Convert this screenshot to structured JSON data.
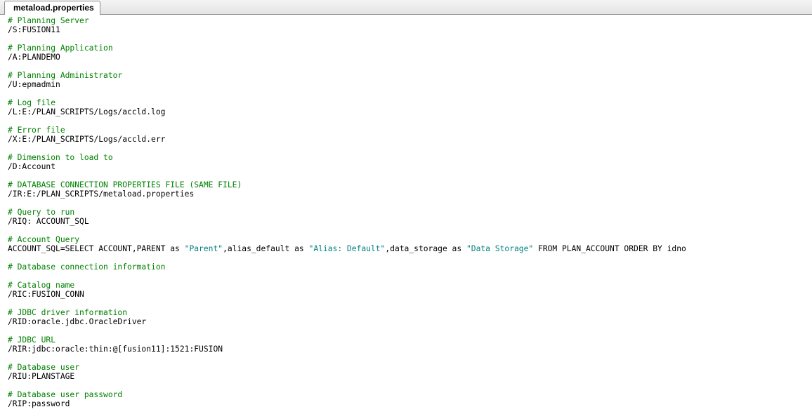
{
  "tab": {
    "label": "metaload.properties"
  },
  "lines": [
    {
      "kind": "comment",
      "text": "# Planning Server"
    },
    {
      "kind": "text",
      "text": "/S:FUSION11"
    },
    {
      "kind": "blank"
    },
    {
      "kind": "comment",
      "text": "# Planning Application"
    },
    {
      "kind": "text",
      "text": "/A:PLANDEMO"
    },
    {
      "kind": "blank"
    },
    {
      "kind": "comment",
      "text": "# Planning Administrator"
    },
    {
      "kind": "text",
      "text": "/U:epmadmin"
    },
    {
      "kind": "blank"
    },
    {
      "kind": "comment",
      "text": "# Log file"
    },
    {
      "kind": "text",
      "text": "/L:E:/PLAN_SCRIPTS/Logs/accld.log"
    },
    {
      "kind": "blank"
    },
    {
      "kind": "comment",
      "text": "# Error file"
    },
    {
      "kind": "text",
      "text": "/X:E:/PLAN_SCRIPTS/Logs/accld.err"
    },
    {
      "kind": "blank"
    },
    {
      "kind": "comment",
      "text": "# Dimension to load to"
    },
    {
      "kind": "text",
      "text": "/D:Account"
    },
    {
      "kind": "blank"
    },
    {
      "kind": "comment",
      "text": "# DATABASE CONNECTION PROPERTIES FILE (SAME FILE)"
    },
    {
      "kind": "text",
      "text": "/IR:E:/PLAN_SCRIPTS/metaload.properties"
    },
    {
      "kind": "blank"
    },
    {
      "kind": "comment",
      "text": "# Query to run"
    },
    {
      "kind": "text",
      "text": "/RIQ: ACCOUNT_SQL"
    },
    {
      "kind": "blank"
    },
    {
      "kind": "comment",
      "text": "# Account Query"
    },
    {
      "kind": "mixed",
      "segments": [
        {
          "type": "text",
          "text": "ACCOUNT_SQL=SELECT ACCOUNT,PARENT as "
        },
        {
          "type": "string",
          "text": "\"Parent\""
        },
        {
          "type": "text",
          "text": ",alias_default as "
        },
        {
          "type": "string",
          "text": "\"Alias: Default\""
        },
        {
          "type": "text",
          "text": ",data_storage as "
        },
        {
          "type": "string",
          "text": "\"Data Storage\""
        },
        {
          "type": "text",
          "text": " FROM PLAN_ACCOUNT ORDER BY idno"
        }
      ]
    },
    {
      "kind": "blank"
    },
    {
      "kind": "comment",
      "text": "# Database connection information"
    },
    {
      "kind": "blank"
    },
    {
      "kind": "comment",
      "text": "# Catalog name"
    },
    {
      "kind": "text",
      "text": "/RIC:FUSION_CONN"
    },
    {
      "kind": "blank"
    },
    {
      "kind": "comment",
      "text": "# JDBC driver information"
    },
    {
      "kind": "text",
      "text": "/RID:oracle.jdbc.OracleDriver"
    },
    {
      "kind": "blank"
    },
    {
      "kind": "comment",
      "text": "# JDBC URL"
    },
    {
      "kind": "text",
      "text": "/RIR:jdbc:oracle:thin:@[fusion11]:1521:FUSION"
    },
    {
      "kind": "blank"
    },
    {
      "kind": "comment",
      "text": "# Database user"
    },
    {
      "kind": "text",
      "text": "/RIU:PLANSTAGE"
    },
    {
      "kind": "blank"
    },
    {
      "kind": "comment",
      "text": "# Database user password"
    },
    {
      "kind": "text",
      "text": "/RIP:password"
    }
  ],
  "colors": {
    "comment": "#008000",
    "string": "#008080",
    "text": "#000000"
  }
}
